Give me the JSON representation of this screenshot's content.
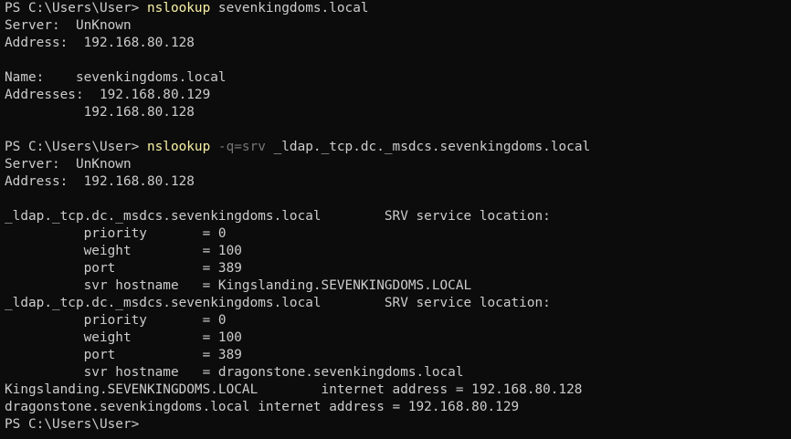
{
  "terminal": {
    "colors": {
      "background": "#0c0c0c",
      "text": "#cccccc",
      "command": "#f9f1a5",
      "flag": "#767676"
    },
    "lines": [
      {
        "type": "command",
        "prompt": "PS C:\\Users\\User> ",
        "cmd": "nslookup",
        "flag": "",
        "args": " sevenkingdoms.local"
      },
      {
        "type": "output",
        "text": "Server:  UnKnown"
      },
      {
        "type": "output",
        "text": "Address:  192.168.80.128"
      },
      {
        "type": "output",
        "text": ""
      },
      {
        "type": "output",
        "text": "Name:    sevenkingdoms.local"
      },
      {
        "type": "output",
        "text": "Addresses:  192.168.80.129"
      },
      {
        "type": "output",
        "text": "          192.168.80.128"
      },
      {
        "type": "output",
        "text": ""
      },
      {
        "type": "command",
        "prompt": "PS C:\\Users\\User> ",
        "cmd": "nslookup",
        "flag": " -q=srv",
        "args": " _ldap._tcp.dc._msdcs.sevenkingdoms.local"
      },
      {
        "type": "output",
        "text": "Server:  UnKnown"
      },
      {
        "type": "output",
        "text": "Address:  192.168.80.128"
      },
      {
        "type": "output",
        "text": ""
      },
      {
        "type": "output",
        "text": "_ldap._tcp.dc._msdcs.sevenkingdoms.local        SRV service location:"
      },
      {
        "type": "output",
        "text": "          priority       = 0"
      },
      {
        "type": "output",
        "text": "          weight         = 100"
      },
      {
        "type": "output",
        "text": "          port           = 389"
      },
      {
        "type": "output",
        "text": "          svr hostname   = Kingslanding.SEVENKINGDOMS.LOCAL"
      },
      {
        "type": "output",
        "text": "_ldap._tcp.dc._msdcs.sevenkingdoms.local        SRV service location:"
      },
      {
        "type": "output",
        "text": "          priority       = 0"
      },
      {
        "type": "output",
        "text": "          weight         = 100"
      },
      {
        "type": "output",
        "text": "          port           = 389"
      },
      {
        "type": "output",
        "text": "          svr hostname   = dragonstone.sevenkingdoms.local"
      },
      {
        "type": "output",
        "text": "Kingslanding.SEVENKINGDOMS.LOCAL        internet address = 192.168.80.128"
      },
      {
        "type": "output",
        "text": "dragonstone.sevenkingdoms.local internet address = 192.168.80.129"
      },
      {
        "type": "prompt",
        "prompt": "PS C:\\Users\\User>"
      }
    ]
  }
}
